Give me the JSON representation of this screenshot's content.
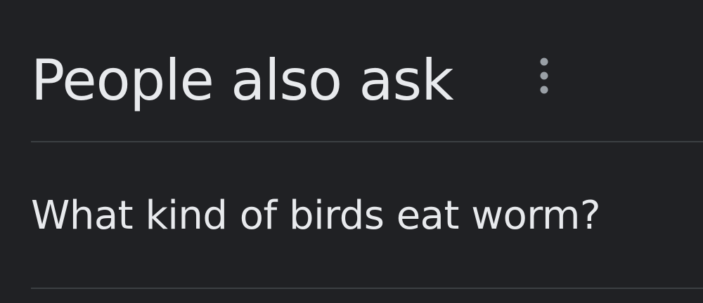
{
  "theme": {
    "background": "#202124",
    "text": "#e8eaed",
    "divider": "#3c4043",
    "icon": "#9aa0a6"
  },
  "section": {
    "title": "People also ask",
    "menu_icon": "vertical-dots-icon",
    "questions": [
      {
        "text": "What kind of birds eat worm?"
      }
    ]
  }
}
